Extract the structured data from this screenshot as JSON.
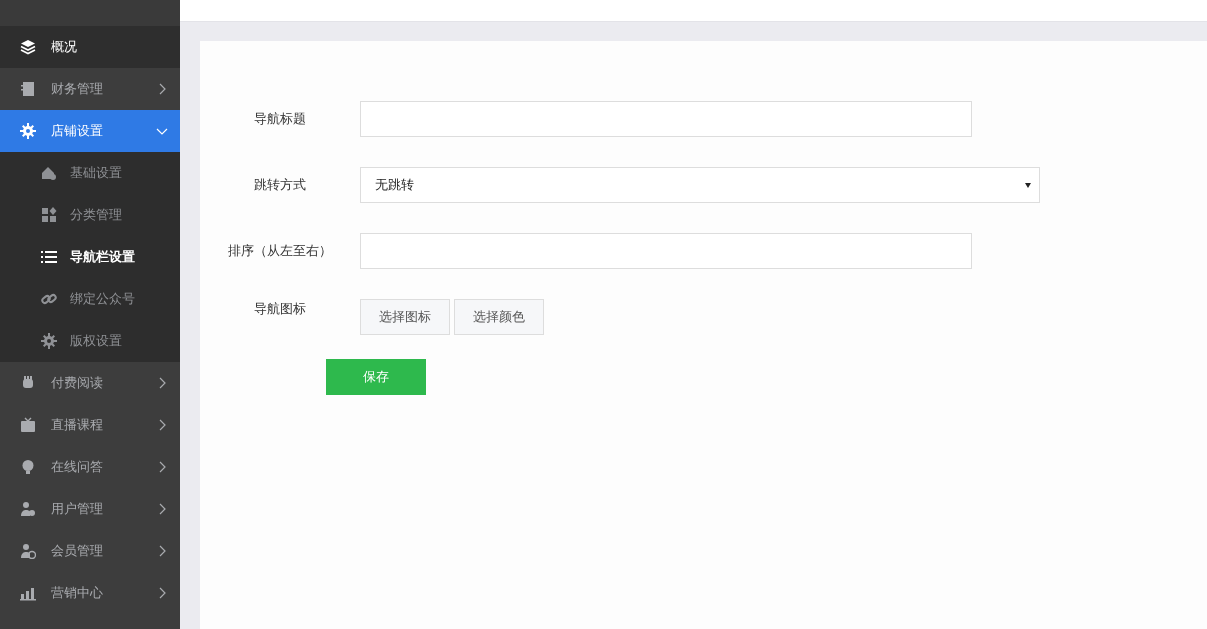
{
  "sidebar": {
    "items": [
      {
        "label": "概况",
        "kind": "leaf",
        "selected": true
      },
      {
        "label": "财务管理",
        "kind": "group",
        "expanded": false
      },
      {
        "label": "店铺设置",
        "kind": "group",
        "expanded": true,
        "children": [
          {
            "label": "基础设置",
            "selected": false
          },
          {
            "label": "分类管理",
            "selected": false
          },
          {
            "label": "导航栏设置",
            "selected": true
          },
          {
            "label": "绑定公众号",
            "selected": false
          },
          {
            "label": "版权设置",
            "selected": false
          }
        ]
      },
      {
        "label": "付费阅读",
        "kind": "group",
        "expanded": false
      },
      {
        "label": "直播课程",
        "kind": "group",
        "expanded": false
      },
      {
        "label": "在线问答",
        "kind": "group",
        "expanded": false
      },
      {
        "label": "用户管理",
        "kind": "group",
        "expanded": false
      },
      {
        "label": "会员管理",
        "kind": "group",
        "expanded": false
      },
      {
        "label": "营销中心",
        "kind": "group",
        "expanded": false
      }
    ]
  },
  "form": {
    "fields": [
      {
        "kind": "text",
        "label": "导航标题"
      },
      {
        "kind": "select",
        "label": "跳转方式",
        "value": "无跳转"
      },
      {
        "kind": "text",
        "label": "排序（从左至右）"
      },
      {
        "kind": "buttons",
        "label": "导航图标",
        "buttons": [
          "选择图标",
          "选择颜色"
        ]
      }
    ],
    "submit": "保存"
  }
}
